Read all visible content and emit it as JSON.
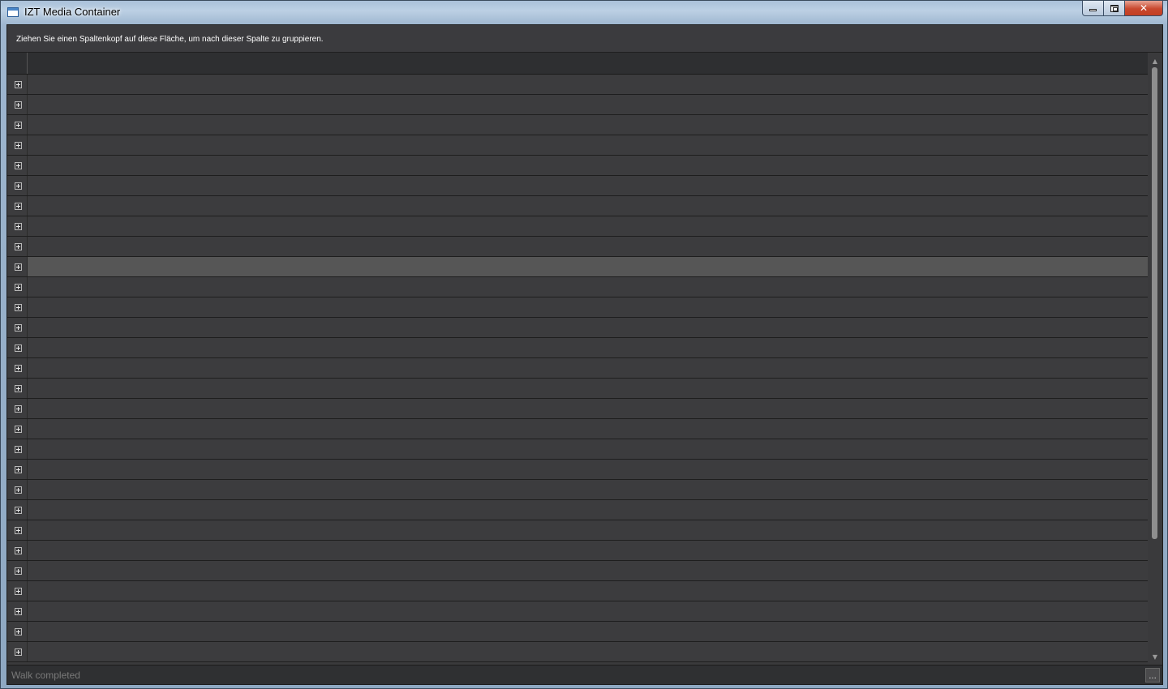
{
  "window": {
    "title": "IZT Media Container"
  },
  "group_panel": {
    "hint": "Ziehen Sie einen Spaltenkopf auf diese Fläche, um nach dieser Spalte zu gruppieren."
  },
  "grid": {
    "row_count": 29,
    "highlighted_row_index": 9,
    "expander_icon": "plus-box-icon"
  },
  "statusbar": {
    "text": "Walk completed",
    "button_label": "..."
  },
  "colors": {
    "background": "#3c3c3e",
    "highlight": "#565656",
    "header": "#2e2f31"
  }
}
